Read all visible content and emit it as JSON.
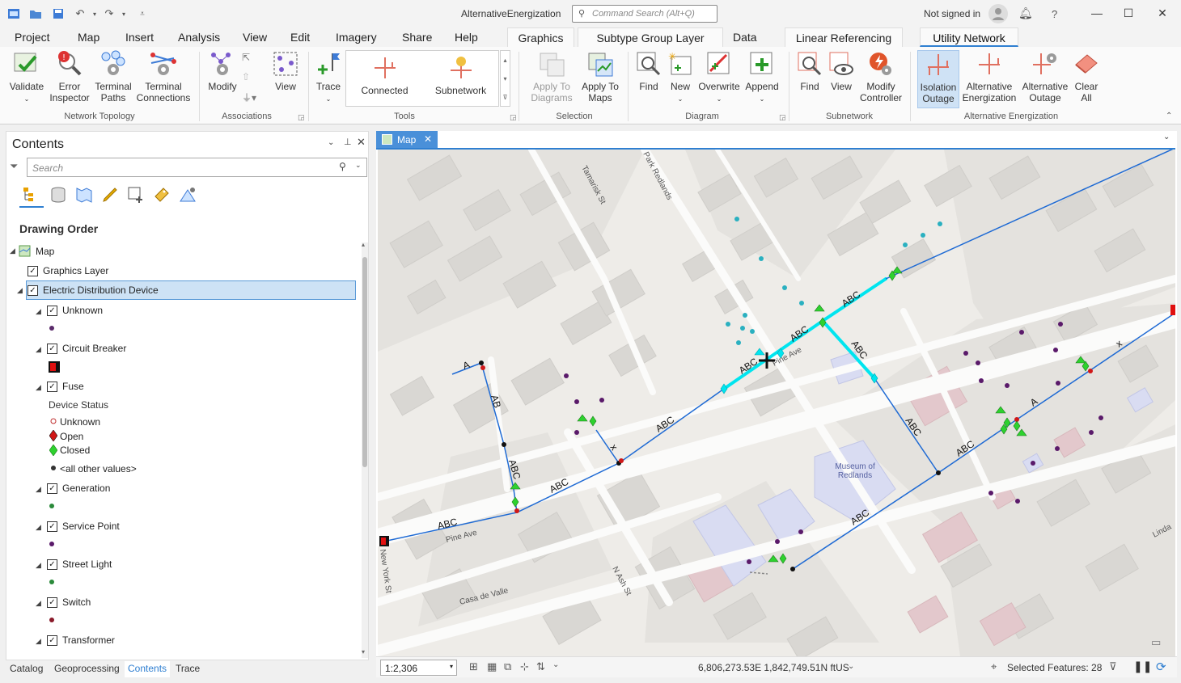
{
  "app": {
    "title": "AlternativeEnergization",
    "command_search_placeholder": "Command Search (Alt+Q)",
    "signin": "Not signed in",
    "help": "?"
  },
  "tabs": [
    "Project",
    "Map",
    "Insert",
    "Analysis",
    "View",
    "Edit",
    "Imagery",
    "Share",
    "Help"
  ],
  "context_tabs": [
    "Graphics",
    "Subtype Group Layer",
    "Data",
    "Linear Referencing",
    "Utility Network"
  ],
  "ribbon": {
    "network_topology": {
      "label": "Network Topology",
      "buttons": [
        "Validate",
        "Error\nInspector",
        "Terminal\nPaths",
        "Terminal\nConnections"
      ]
    },
    "associations": {
      "label": "Associations",
      "buttons": [
        "Modify",
        "View"
      ]
    },
    "tools": {
      "label": "Tools",
      "trace": "Trace",
      "gallery": [
        "Connected",
        "Subnetwork"
      ]
    },
    "selection": {
      "label": "Selection",
      "buttons": [
        "Apply To\nDiagrams",
        "Apply To\nMaps"
      ]
    },
    "diagram": {
      "label": "Diagram",
      "buttons": [
        "Find",
        "New",
        "Overwrite",
        "Append"
      ]
    },
    "subnetwork": {
      "label": "Subnetwork",
      "buttons": [
        "Find",
        "View",
        "Modify\nController"
      ]
    },
    "alt_energization": {
      "label": "Alternative Energization",
      "buttons": [
        "Isolation\nOutage",
        "Alternative\nEnergization",
        "Alternative\nOutage",
        "Clear\nAll"
      ]
    }
  },
  "contents": {
    "title": "Contents",
    "search_placeholder": "Search",
    "drawing_order": "Drawing Order",
    "map": "Map",
    "graphics_layer": "Graphics Layer",
    "edd": "Electric Distribution Device",
    "unknown": "Unknown",
    "circuit_breaker": "Circuit Breaker",
    "fuse": "Fuse",
    "device_status": "Device Status",
    "status_unknown": "Unknown",
    "status_open": "Open",
    "status_closed": "Closed",
    "status_other": "<all other values>",
    "generation": "Generation",
    "service_point": "Service Point",
    "street_light": "Street Light",
    "switch": "Switch",
    "transformer": "Transformer"
  },
  "bottom_tabs": [
    "Catalog",
    "Geoprocessing",
    "Contents",
    "Trace"
  ],
  "map": {
    "tab": "Map",
    "streets": [
      "Tamarisk St",
      "Park Redlands",
      "Pine Ave",
      "Pine Ave",
      "New York St",
      "N Ash St",
      "Casa de Valle",
      "Linda"
    ],
    "poi": "Museum of\nRedlands",
    "line_labels": [
      "A",
      "AB",
      "ABC",
      "ABC",
      "ABC",
      "ABC",
      "ABC",
      "ABC",
      "ABC",
      "ABC",
      "ABC",
      "ABC",
      "ABC",
      "A"
    ]
  },
  "status": {
    "scale": "1:2,306",
    "coords": "6,806,273.53E 1,842,749.51N ftUS",
    "selected": "Selected Features: 28"
  },
  "colors": {
    "accent": "#2f7fd1",
    "trace": "#00e5ef",
    "line": "#1e6ad4",
    "closed": "#2ed12e",
    "open": "#d01818"
  }
}
